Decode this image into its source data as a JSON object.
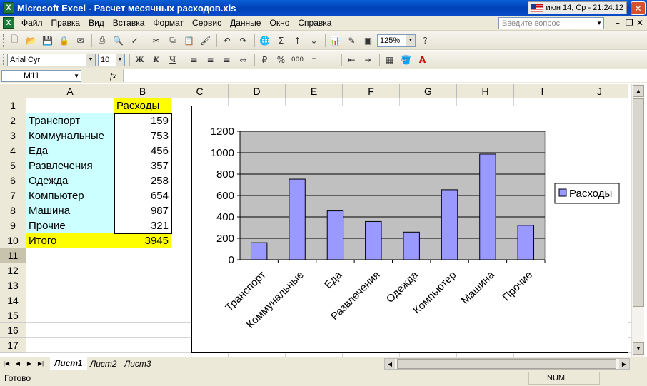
{
  "window": {
    "title": "Microsoft Excel - Расчет месячных расходов.xls",
    "clock": "июн 14, Ср - 21:24:12",
    "close_glyph": "✕"
  },
  "menu": {
    "items": [
      "Файл",
      "Правка",
      "Вид",
      "Вставка",
      "Формат",
      "Сервис",
      "Данные",
      "Окно",
      "Справка"
    ],
    "question_placeholder": "Введите вопрос"
  },
  "toolbar_standard": {
    "zoom": "125%",
    "icons": [
      "new-icon",
      "open-icon",
      "save-icon",
      "permission-icon",
      "email-icon",
      "print-icon",
      "print-preview-icon",
      "spelling-icon",
      "cut-icon",
      "copy-icon",
      "paste-icon",
      "format-painter-icon",
      "undo-icon",
      "redo-icon",
      "hyperlink-icon",
      "autosum-icon",
      "sort-asc-icon",
      "sort-desc-icon",
      "chart-wizard-icon",
      "drawing-icon",
      "pdf-icon",
      "help-icon"
    ]
  },
  "toolbar_format": {
    "font": "Arial Cyr",
    "size": "10",
    "bold": "Ж",
    "italic": "К",
    "underline": "Ч",
    "currency": "₽",
    "percent": "%",
    "thousands": "000"
  },
  "formula_bar": {
    "name_box": "M11",
    "fx": "fx",
    "formula": ""
  },
  "sheet": {
    "columns": [
      "A",
      "B",
      "C",
      "D",
      "E",
      "F",
      "G",
      "H",
      "I",
      "J"
    ],
    "rows": [
      "1",
      "2",
      "3",
      "4",
      "5",
      "6",
      "7",
      "8",
      "9",
      "10",
      "11",
      "12",
      "13",
      "14",
      "15",
      "16",
      "17"
    ],
    "selected_row": "11",
    "header_cell": "Расходы",
    "items": [
      {
        "label": "Транспорт",
        "value": "159"
      },
      {
        "label": "Коммунальные",
        "value": "753"
      },
      {
        "label": "Еда",
        "value": "456"
      },
      {
        "label": "Развлечения",
        "value": "357"
      },
      {
        "label": "Одежда",
        "value": "258"
      },
      {
        "label": "Компьютер",
        "value": "654"
      },
      {
        "label": "Машина",
        "value": "987"
      },
      {
        "label": "Прочие",
        "value": "321"
      }
    ],
    "total_label": "Итого",
    "total_value": "3945",
    "colors": {
      "label_fill": "#ccffff",
      "highlight_fill": "#ffff00",
      "header_fill": "#ece9d8"
    }
  },
  "chart_data": {
    "type": "bar",
    "categories": [
      "Транспорт",
      "Коммунальные",
      "Еда",
      "Развлечения",
      "Одежда",
      "Компьютер",
      "Машина",
      "Прочие"
    ],
    "series": [
      {
        "name": "Расходы",
        "values": [
          159,
          753,
          456,
          357,
          258,
          654,
          987,
          321
        ],
        "color": "#9999ff"
      }
    ],
    "yticks": [
      0,
      200,
      400,
      600,
      800,
      1000,
      1200
    ],
    "ylim": [
      0,
      1200
    ],
    "plot_bg": "#c0c0c0",
    "legend_position": "right",
    "grid": "horizontal"
  },
  "tabs": {
    "sheets": [
      "Лист1",
      "Лист2",
      "Лист3"
    ],
    "active": "Лист1"
  },
  "status": {
    "left": "Готово",
    "num": "NUM"
  }
}
